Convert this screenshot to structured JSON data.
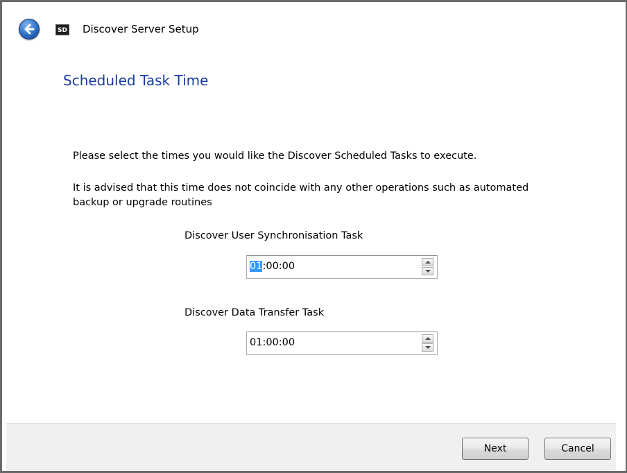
{
  "window": {
    "title": "Discover Server Setup",
    "app_icon_text": "SD"
  },
  "page": {
    "heading": "Scheduled Task Time",
    "instruction": "Please select the times you would like the Discover Scheduled Tasks to execute.",
    "advice_line1": "It is advised that this time does not coincide with any other operations such as automated",
    "advice_line2": "backup or upgrade routines"
  },
  "tasks": [
    {
      "label": "Discover User Synchronisation Task",
      "value_selected": "01",
      "value_rest": ":00:00"
    },
    {
      "label": "Discover Data Transfer Task",
      "value": "01:00:00"
    }
  ],
  "footer": {
    "next_label": "Next",
    "cancel_label": "Cancel"
  },
  "icons": {
    "back": "back-arrow-icon",
    "app": "app-icon",
    "spin_up": "chevron-up-icon",
    "spin_down": "chevron-down-icon"
  },
  "colors": {
    "heading": "#1a3c9e",
    "selection": "#3399ff",
    "footer_bg": "#f0f0f0"
  }
}
